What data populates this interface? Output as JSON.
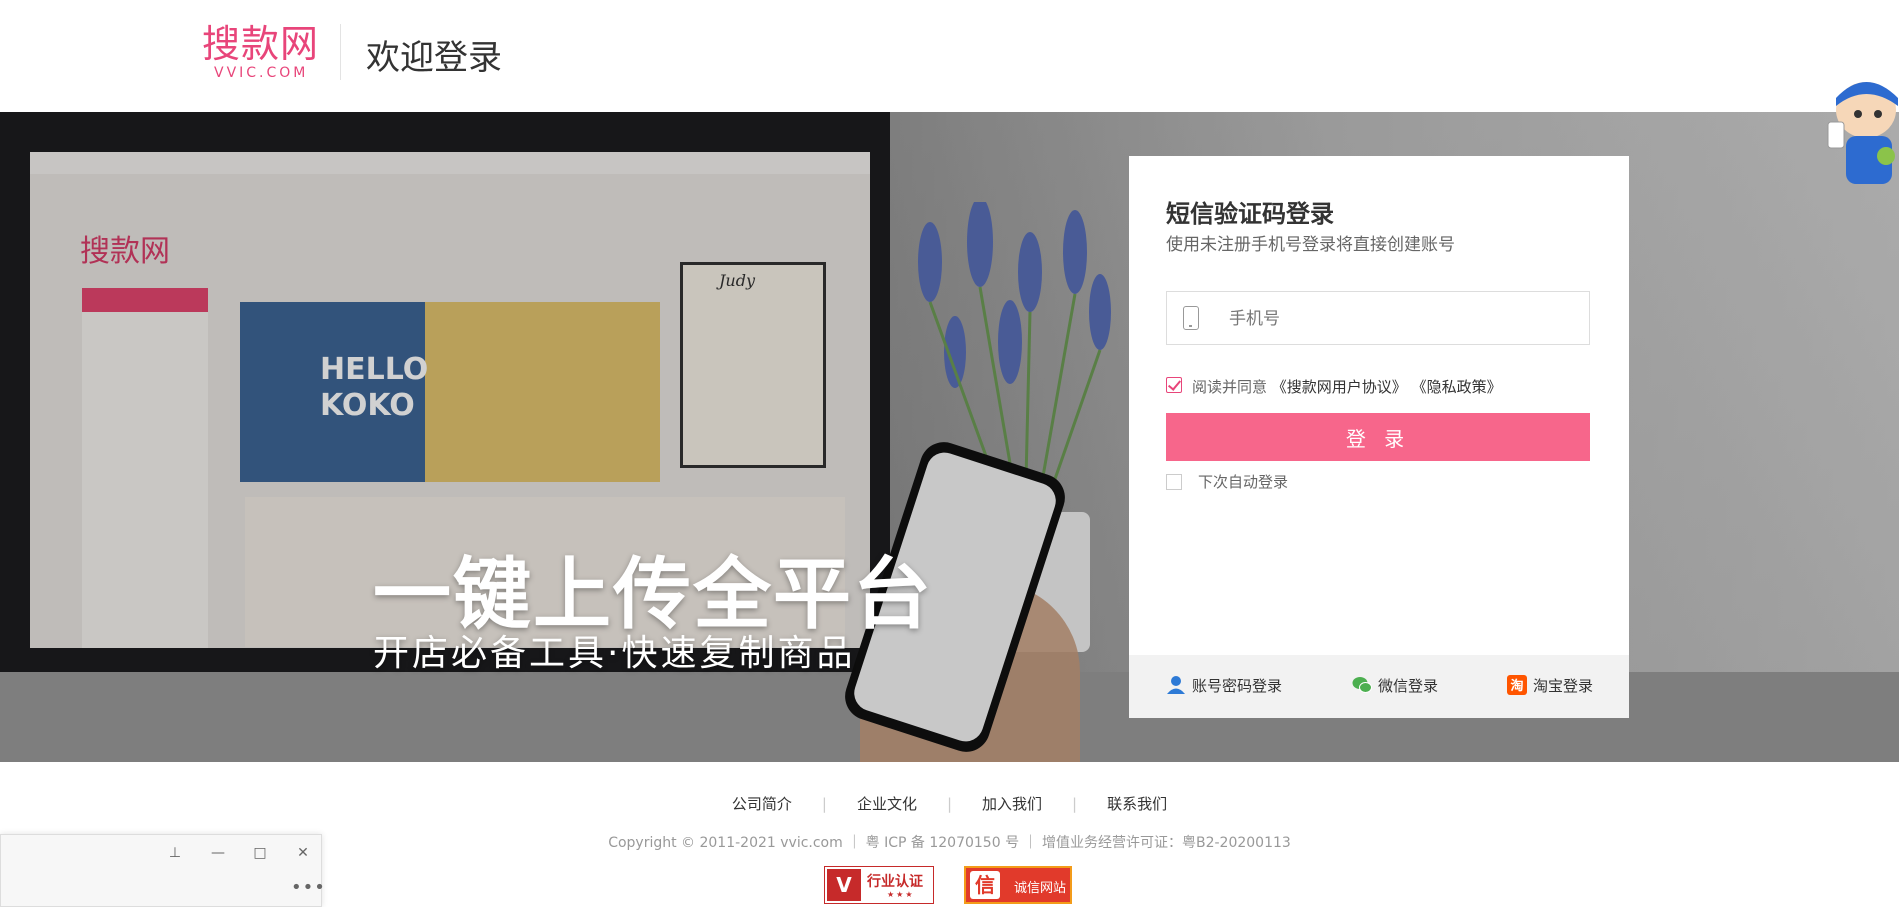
{
  "header": {
    "logo_cn": "搜款网",
    "logo_en": "VVIC.COM",
    "title": "欢迎登录"
  },
  "banner": {
    "headline": "一键上传全平台",
    "subheadline": "开店必备工具·快速复制商品",
    "screen_text": {
      "logo": "搜款网",
      "promo_line1": "HELLO",
      "promo_line2": "KOKO",
      "promo_tag": "Judy"
    }
  },
  "login": {
    "title": "短信验证码登录",
    "subtitle": "使用未注册手机号登录将直接创建账号",
    "phone_placeholder": "手机号",
    "agree_prefix": "阅读并同意",
    "agree_link1": "《搜款网用户协议》",
    "agree_link2": "《隐私政策》",
    "agree_checked": true,
    "submit_label": "登 录",
    "auto_login_label": "下次自动登录",
    "auto_login_checked": false,
    "alt_methods": [
      {
        "label": "账号密码登录",
        "icon": "user-icon"
      },
      {
        "label": "微信登录",
        "icon": "wechat-icon"
      },
      {
        "label": "淘宝登录",
        "icon": "taobao-icon"
      }
    ]
  },
  "footer": {
    "links": [
      "公司简介",
      "企业文化",
      "加入我们",
      "联系我们"
    ],
    "copyright": "Copyright © 2011-2021 vvic.com ｜ 粤 ICP 备 12070150 号 ｜ 增值业务经营许可证：粤B2-20200113",
    "badge1_text": "行业认证",
    "badge1_logo": "V",
    "badge1_stars": "★★★",
    "badge2_text": "诚信网站",
    "badge2_logo": "信"
  },
  "mini_window": {
    "pin": "⊥",
    "minimize": "—",
    "maximize": "□",
    "close": "✕",
    "more": "•••"
  },
  "colors": {
    "brand_pink": "#e8457a",
    "button_pink": "#f7668b"
  }
}
